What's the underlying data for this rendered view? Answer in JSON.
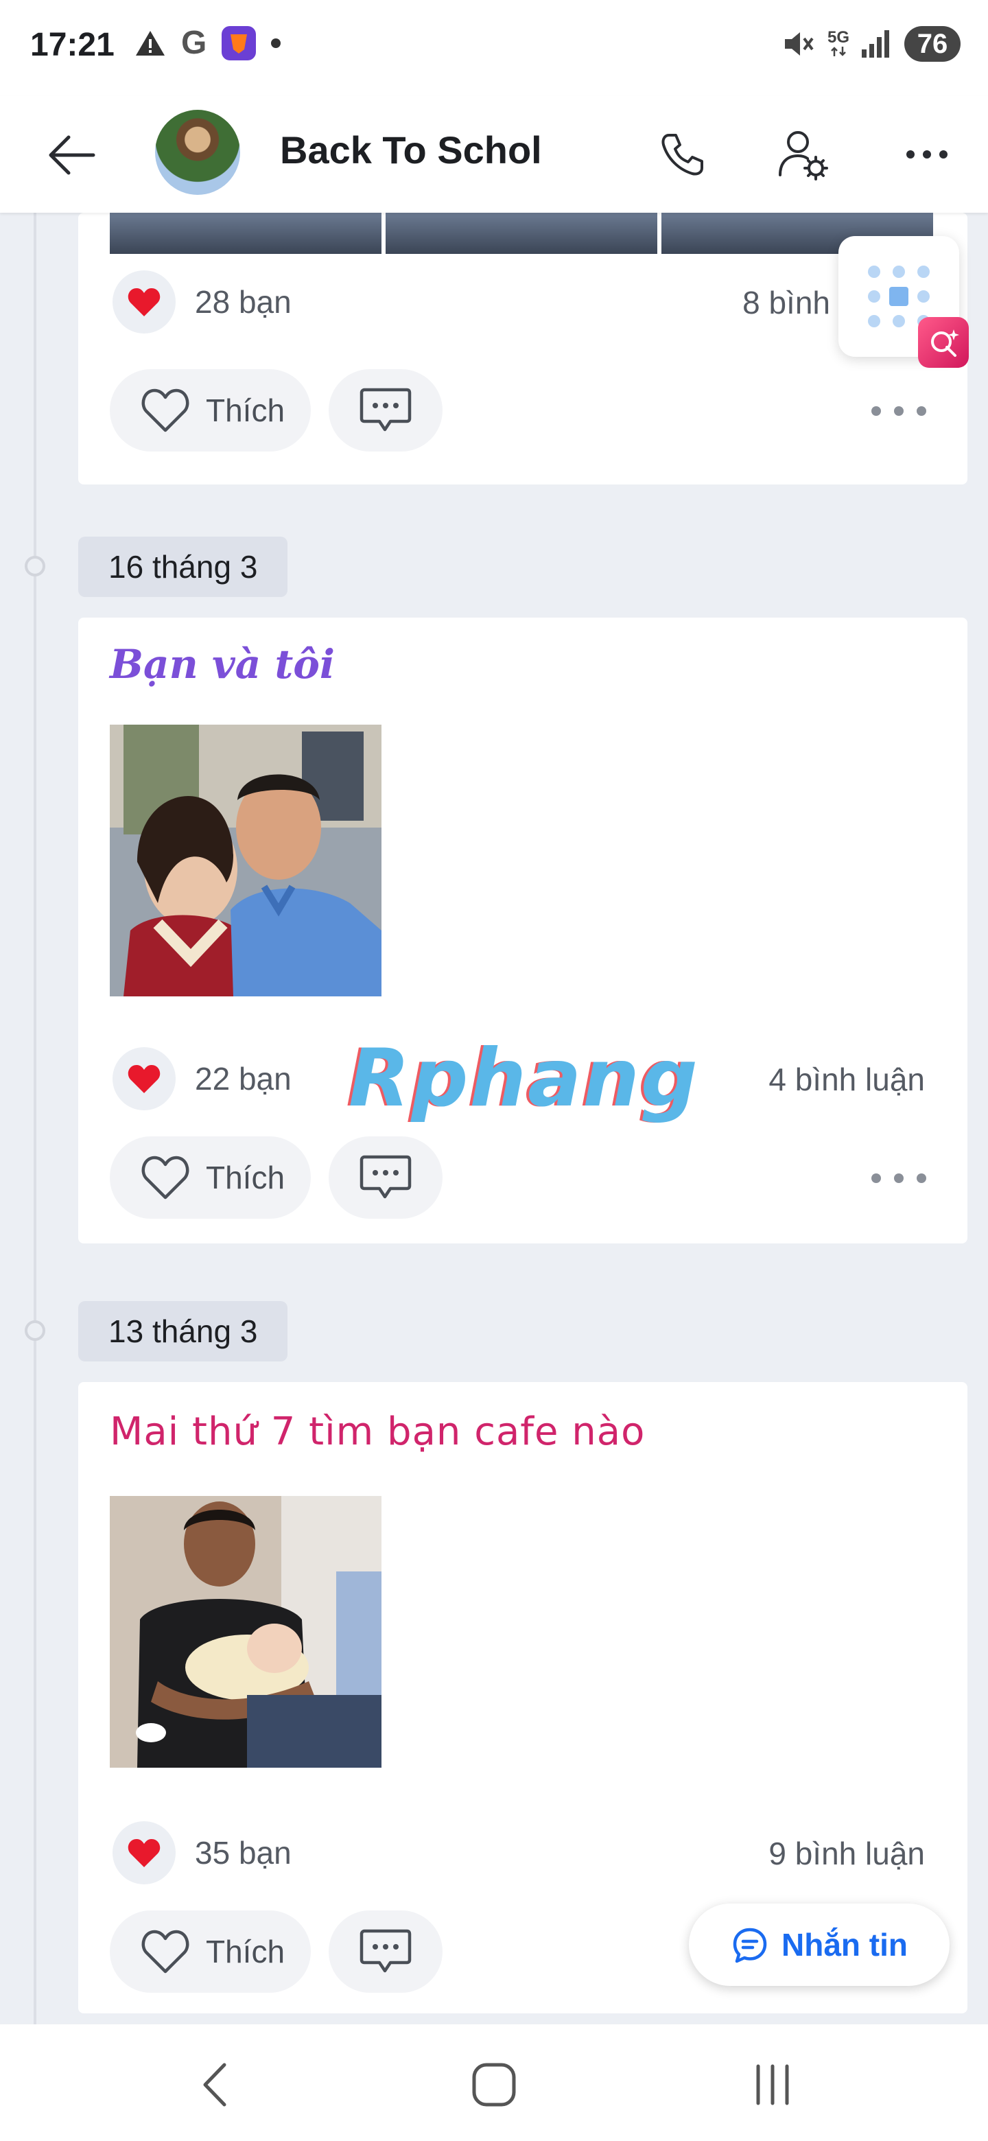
{
  "status_bar": {
    "time": "17:21",
    "google_letter": "G",
    "network": "5G",
    "battery": "76"
  },
  "header": {
    "title": "Back To Schol"
  },
  "posts": [
    {
      "reactions": "28 bạn",
      "comments": "8 bình",
      "like_label": "Thích"
    },
    {
      "date": "16 tháng 3",
      "title": "Bạn và tôi",
      "reactions": "22 bạn",
      "comments": "4 bình luận",
      "like_label": "Thích"
    },
    {
      "date": "13 tháng 3",
      "title": "Mai thứ 7 tìm bạn cafe nào",
      "reactions": "35 bạn",
      "comments": "9 bình luận",
      "like_label": "Thích"
    }
  ],
  "watermark": "Rphang",
  "message_button": "Nhắn tin",
  "colors": {
    "accent": "#1a6bf0",
    "heart": "#e8192c",
    "title_purple": "#7b4fd8",
    "title_pink": "#d0246b"
  }
}
